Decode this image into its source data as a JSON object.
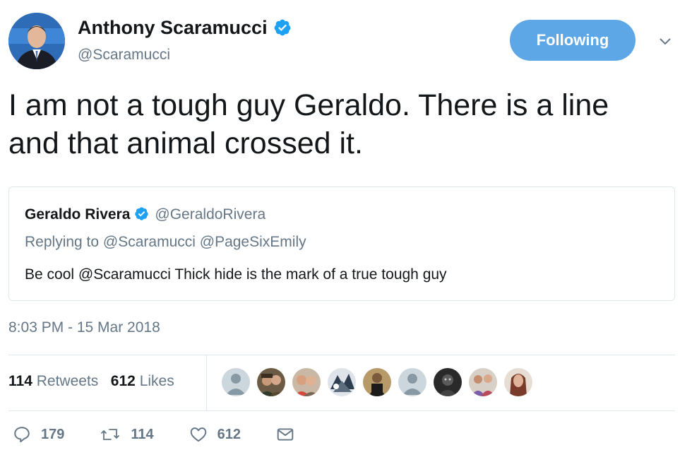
{
  "author": {
    "name": "Anthony Scaramucci",
    "handle": "@Scaramucci",
    "avatar_icon": "profile-photo",
    "verified_icon": "verified-badge-icon"
  },
  "follow_button": {
    "label": "Following"
  },
  "tweet": {
    "text_line1": "I am not a tough guy Geraldo. There is a line",
    "text_line2": "and that animal crossed it.",
    "timestamp": "8:03 PM - 15 Mar 2018"
  },
  "quoted_tweet": {
    "name": "Geraldo Rivera",
    "handle": "@GeraldoRivera",
    "replying_to": "Replying to @Scaramucci @PageSixEmily",
    "text": "Be cool @Scaramucci Thick hide is the mark of a true tough guy"
  },
  "stats": {
    "retweets_count": "114",
    "retweets_label": "Retweets",
    "likes_count": "612",
    "likes_label": "Likes"
  },
  "actions": {
    "reply_count": "179",
    "retweet_count": "114",
    "like_count": "612"
  },
  "colors": {
    "accent": "#5da7e6",
    "verified": "#1da1f2",
    "secondary_text": "#657786"
  }
}
